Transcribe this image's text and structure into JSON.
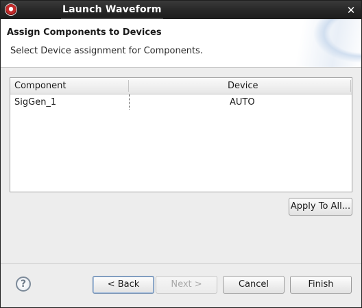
{
  "window": {
    "title": "Launch Waveform",
    "close_glyph": "✕"
  },
  "header": {
    "heading": "Assign Components to Devices",
    "description": "Select Device assignment for Components."
  },
  "table": {
    "columns": [
      "Component",
      "Device"
    ],
    "rows": [
      {
        "component": "SigGen_1",
        "device": "AUTO"
      }
    ]
  },
  "buttons": {
    "apply_to_all": "Apply To All...",
    "back": "< Back",
    "next": "Next >",
    "cancel": "Cancel",
    "finish": "Finish"
  },
  "help": {
    "glyph": "?"
  },
  "colors": {
    "titlebar": "#262626",
    "default_button_border": "#5d7fa8",
    "disabled_text": "#a8a8a8"
  },
  "icons": {
    "app": "app-logo-icon",
    "close": "close-icon",
    "help": "help-icon"
  }
}
